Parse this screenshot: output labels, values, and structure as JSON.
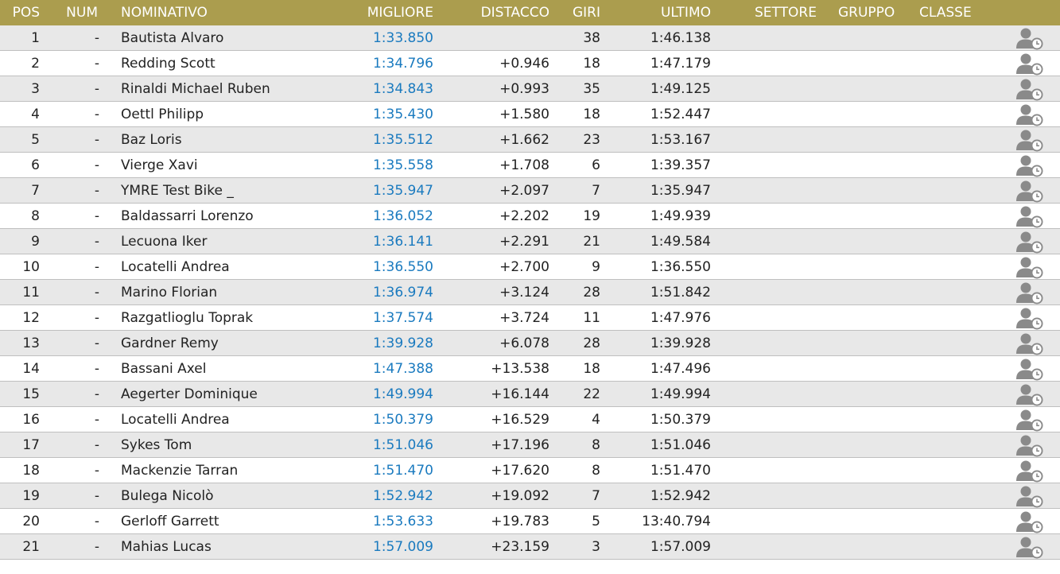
{
  "header": {
    "pos": "POS",
    "num": "NUM",
    "name": "NOMINATIVO",
    "best": "MIGLIORE",
    "gap": "DISTACCO",
    "laps": "GIRI",
    "last": "ULTIMO",
    "sector": "SETTORE",
    "group": "GRUPPO",
    "class": "CLASSE"
  },
  "colors": {
    "header_bg": "#ab9d4e",
    "header_text": "#ffffff",
    "best_time": "#1a7abf",
    "row_alt": "#e8e8e8",
    "icon": "#8a8a8a"
  },
  "icon_name": "driver-history-icon",
  "rows": [
    {
      "pos": "1",
      "num": "-",
      "name": "Bautista Alvaro",
      "best": "1:33.850",
      "gap": "",
      "laps": "38",
      "last": "1:46.138"
    },
    {
      "pos": "2",
      "num": "-",
      "name": "Redding Scott",
      "best": "1:34.796",
      "gap": "+0.946",
      "laps": "18",
      "last": "1:47.179"
    },
    {
      "pos": "3",
      "num": "-",
      "name": "Rinaldi Michael Ruben",
      "best": "1:34.843",
      "gap": "+0.993",
      "laps": "35",
      "last": "1:49.125"
    },
    {
      "pos": "4",
      "num": "-",
      "name": "Oettl Philipp",
      "best": "1:35.430",
      "gap": "+1.580",
      "laps": "18",
      "last": "1:52.447"
    },
    {
      "pos": "5",
      "num": "-",
      "name": "Baz Loris",
      "best": "1:35.512",
      "gap": "+1.662",
      "laps": "23",
      "last": "1:53.167"
    },
    {
      "pos": "6",
      "num": "-",
      "name": "Vierge Xavi",
      "best": "1:35.558",
      "gap": "+1.708",
      "laps": "6",
      "last": "1:39.357"
    },
    {
      "pos": "7",
      "num": "-",
      "name": "YMRE Test Bike _",
      "best": "1:35.947",
      "gap": "+2.097",
      "laps": "7",
      "last": "1:35.947"
    },
    {
      "pos": "8",
      "num": "-",
      "name": "Baldassarri Lorenzo",
      "best": "1:36.052",
      "gap": "+2.202",
      "laps": "19",
      "last": "1:49.939"
    },
    {
      "pos": "9",
      "num": "-",
      "name": "Lecuona Iker",
      "best": "1:36.141",
      "gap": "+2.291",
      "laps": "21",
      "last": "1:49.584"
    },
    {
      "pos": "10",
      "num": "-",
      "name": "Locatelli Andrea",
      "best": "1:36.550",
      "gap": "+2.700",
      "laps": "9",
      "last": "1:36.550"
    },
    {
      "pos": "11",
      "num": "-",
      "name": "Marino Florian",
      "best": "1:36.974",
      "gap": "+3.124",
      "laps": "28",
      "last": "1:51.842"
    },
    {
      "pos": "12",
      "num": "-",
      "name": "Razgatlioglu Toprak",
      "best": "1:37.574",
      "gap": "+3.724",
      "laps": "11",
      "last": "1:47.976"
    },
    {
      "pos": "13",
      "num": "-",
      "name": "Gardner Remy",
      "best": "1:39.928",
      "gap": "+6.078",
      "laps": "28",
      "last": "1:39.928"
    },
    {
      "pos": "14",
      "num": "-",
      "name": "Bassani Axel",
      "best": "1:47.388",
      "gap": "+13.538",
      "laps": "18",
      "last": "1:47.496"
    },
    {
      "pos": "15",
      "num": "-",
      "name": "Aegerter Dominique",
      "best": "1:49.994",
      "gap": "+16.144",
      "laps": "22",
      "last": "1:49.994"
    },
    {
      "pos": "16",
      "num": "-",
      "name": "Locatelli Andrea",
      "best": "1:50.379",
      "gap": "+16.529",
      "laps": "4",
      "last": "1:50.379"
    },
    {
      "pos": "17",
      "num": "-",
      "name": "Sykes Tom",
      "best": "1:51.046",
      "gap": "+17.196",
      "laps": "8",
      "last": "1:51.046"
    },
    {
      "pos": "18",
      "num": "-",
      "name": "Mackenzie Tarran",
      "best": "1:51.470",
      "gap": "+17.620",
      "laps": "8",
      "last": "1:51.470"
    },
    {
      "pos": "19",
      "num": "-",
      "name": "Bulega Nicolò",
      "best": "1:52.942",
      "gap": "+19.092",
      "laps": "7",
      "last": "1:52.942"
    },
    {
      "pos": "20",
      "num": "-",
      "name": "Gerloff Garrett",
      "best": "1:53.633",
      "gap": "+19.783",
      "laps": "5",
      "last": "13:40.794"
    },
    {
      "pos": "21",
      "num": "-",
      "name": "Mahias Lucas",
      "best": "1:57.009",
      "gap": "+23.159",
      "laps": "3",
      "last": "1:57.009"
    }
  ]
}
